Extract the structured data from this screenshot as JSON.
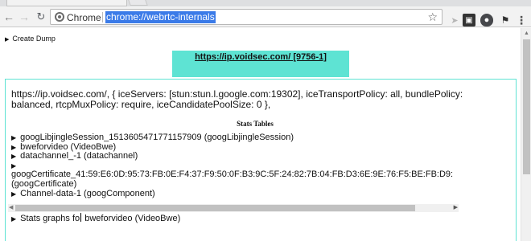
{
  "browser": {
    "tab_title": "WebRTC Internals",
    "chip_label": "Chrome",
    "url": "chrome://webrtc-internals"
  },
  "page": {
    "create_dump_label": "Create Dump",
    "peer_connection_tab": "https://ip.voidsec.com/ [9756-1]",
    "configuration_text": "https://ip.voidsec.com/, { iceServers: [stun:stun.l.google.com:19302], iceTransportPolicy: all, bundlePolicy: balanced, rtcpMuxPolicy: require, iceCandidatePoolSize: 0 },",
    "stats_heading": "Stats Tables",
    "stats_items": [
      "googLibjingleSession_1513605471771157909 (googLibjingleSession)",
      "bweforvideo (VideoBwe)",
      "datachannel_-1 (datachannel)",
      "",
      "googCertificate_41:59:E6:0D:95:73:FB:0E:F4:37:F9:50:0F:B3:9C:5F:24:82:7B:04:FB:D3:6E:9E:76:F5:BE:FB:D9:",
      "(googCertificate)",
      "Channel-data-1 (googComponent)"
    ],
    "graphs_prefix": "Stats graphs fo",
    "graphs_suffix": " bweforvideo (VideoBwe)"
  },
  "colors": {
    "accent_teal": "#5ee3d3",
    "url_highlight": "#3b7be8"
  }
}
